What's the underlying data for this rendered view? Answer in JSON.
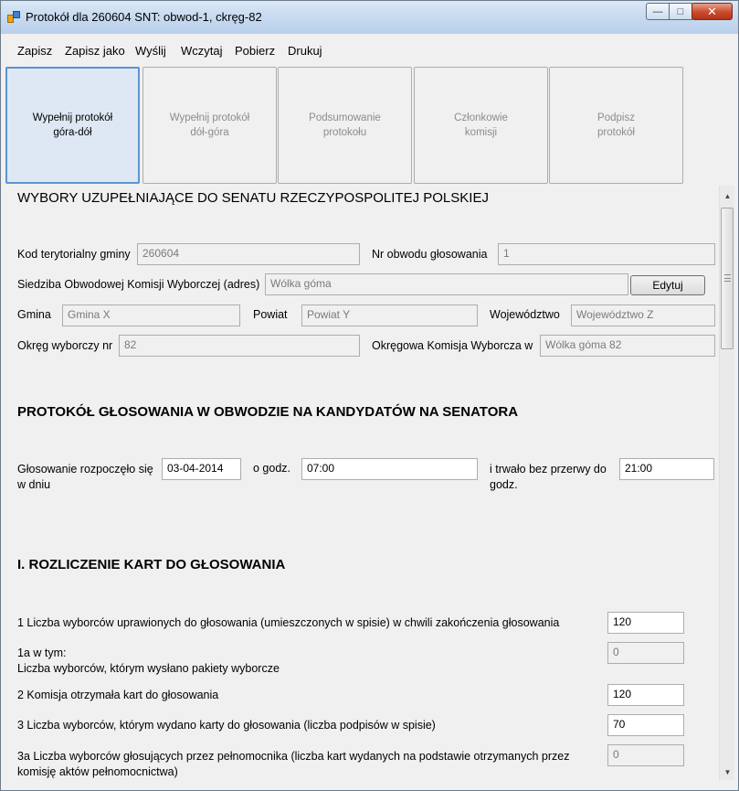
{
  "window": {
    "title": "Protokół dla 260604 SNT: obwod-1, ckręg-82",
    "controls": {
      "minimize": "—",
      "maximize": "□",
      "close": "✕"
    }
  },
  "menu": [
    "Zapisz",
    "Zapisz jako",
    "Wyślij",
    "Wczytaj",
    "Pobierz",
    "Drukuj"
  ],
  "tabs": [
    {
      "label": "Wypełnij protokół\ngóra-dół",
      "active": true
    },
    {
      "label": "Wypełnij protokół\ndół-góra",
      "active": false
    },
    {
      "label": "Podsumowanie\nprotokołu",
      "active": false
    },
    {
      "label": "Członkowie\nkomisji",
      "active": false
    },
    {
      "label": "Podpisz\nprotokół",
      "active": false
    }
  ],
  "form": {
    "main_title": "WYBORY UZUPEŁNIAJĄCE DO SENATU RZECZYPOSPOLITEJ POLSKIEJ",
    "kod_label": "Kod terytorialny gminy",
    "kod_value": "260604",
    "nr_obwodu_label": "Nr obwodu głosowania",
    "nr_obwodu_value": "1",
    "siedziba_label": "Siedziba Obwodowej Komisji Wyborczej (adres)",
    "siedziba_value": "Wólka góma",
    "edit_button": "Edytuj",
    "gmina_label": "Gmina",
    "gmina_value": "Gmina X",
    "powiat_label": "Powiat",
    "powiat_value": "Powiat Y",
    "wojewodztwo_label": "Województwo",
    "wojewodztwo_value": "Województwo Z",
    "okreg_label": "Okręg wyborczy nr",
    "okreg_value": "82",
    "okw_label": "Okręgowa Komisja Wyborcza w",
    "okw_value": "Wólka góma 82",
    "protokol_title": "PROTOKÓŁ GŁOSOWANIA W OBWODZIE  NA KANDYDATÓW NA SENATORA",
    "start_label": "Głosowanie rozpoczęło się w dniu",
    "start_date": "03-04-2014",
    "o_godz_label": "o godz.",
    "start_time": "07:00",
    "end_label": "i trwało bez przerwy do godz.",
    "end_time": "21:00",
    "section1_title": "I. ROZLICZENIE KART DO GŁOSOWANIA",
    "rows": [
      {
        "label": "1 Liczba wyborców uprawionych do głosowania (umieszczonych w spisie) w chwili zakończenia głosowania",
        "value": "120",
        "editable": true
      },
      {
        "label": "1a w tym:\nLiczba wyborców, którym wysłano pakiety wyborcze",
        "value": "0",
        "editable": false
      },
      {
        "label": "2 Komisja otrzymała kart do głosowania",
        "value": "120",
        "editable": true
      },
      {
        "label": "3 Liczba wyborców, którym wydano karty do głosowania (liczba podpisów w spisie)",
        "value": "70",
        "editable": true
      },
      {
        "label": "3a Liczba wyborców głosujących przez pełnomocnika (liczba kart wydanych na podstawie otrzymanych przez komisję aktów pełnomocnictwa)",
        "value": "0",
        "editable": false
      }
    ]
  },
  "scrollbar": {
    "up": "▲",
    "down": "▼"
  }
}
